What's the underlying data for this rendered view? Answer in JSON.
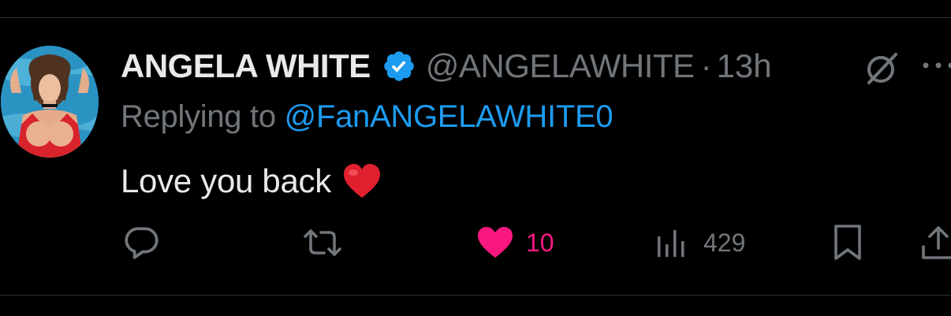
{
  "tweet": {
    "author_name": "ANGELA WHITE",
    "author_handle": "@ANGELAWHITE",
    "separator": "·",
    "timestamp": "13h",
    "reply_prefix": "Replying to ",
    "reply_to": "@FanANGELAWHITE0",
    "text": "Love you back",
    "verified": true
  },
  "actions": {
    "reply_count": "",
    "retweet_count": "",
    "like_count": "10",
    "views_count": "429"
  },
  "icons": {
    "reply": "reply-icon",
    "retweet": "retweet-icon",
    "like": "heart-filled-icon",
    "views": "views-icon",
    "bookmark": "bookmark-icon",
    "share": "share-icon",
    "grok": "grok-icon",
    "more": "more-icon",
    "verified": "verified-badge-icon",
    "emoji": "red-heart-emoji"
  },
  "colors": {
    "background": "#000000",
    "text_primary": "#e7e9ea",
    "text_secondary": "#71767b",
    "link": "#1d9bf0",
    "like": "#f91880",
    "verified": "#1d9bf0",
    "divider": "#2f3336"
  }
}
